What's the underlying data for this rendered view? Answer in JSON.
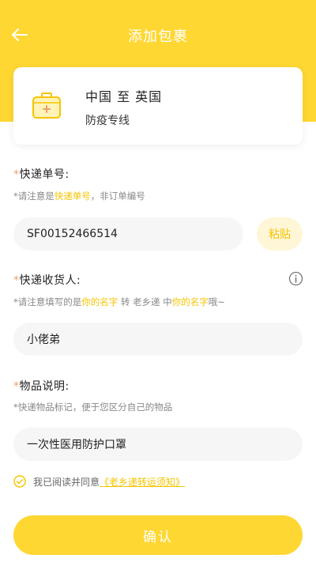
{
  "header": {
    "title": "添加包裹",
    "background_color": "#fed732"
  },
  "route_card": {
    "route": "中国 至 英国",
    "service": "防疫专线",
    "icon": "medical-kit-icon"
  },
  "tracking": {
    "label": "快递单号:",
    "hint_prefix": "*请注意是",
    "hint_highlight": "快递单号",
    "hint_suffix": "，非订单编号",
    "value": "SF00152466514",
    "paste_label": "粘贴"
  },
  "recipient": {
    "label": "快递收货人:",
    "hint_prefix": "*请注意填写的是",
    "hint_highlight_1": "你的名字",
    "hint_middle": " 转 老乡递 中",
    "hint_highlight_2": "你的名字",
    "hint_suffix": "哦~",
    "value": "小佬弟"
  },
  "item": {
    "label": "物品说明:",
    "hint": "*快递物品标记，便于您区分自己的物品",
    "value": "一次性医用防护口罩"
  },
  "agreement": {
    "text": "我已阅读并同意",
    "link": "《老乡递转运须知》",
    "checked": true
  },
  "confirm": {
    "label": "确认"
  },
  "colors": {
    "accent": "#fed732",
    "highlight": "#f5c400",
    "required_star": "#f0a06a"
  }
}
